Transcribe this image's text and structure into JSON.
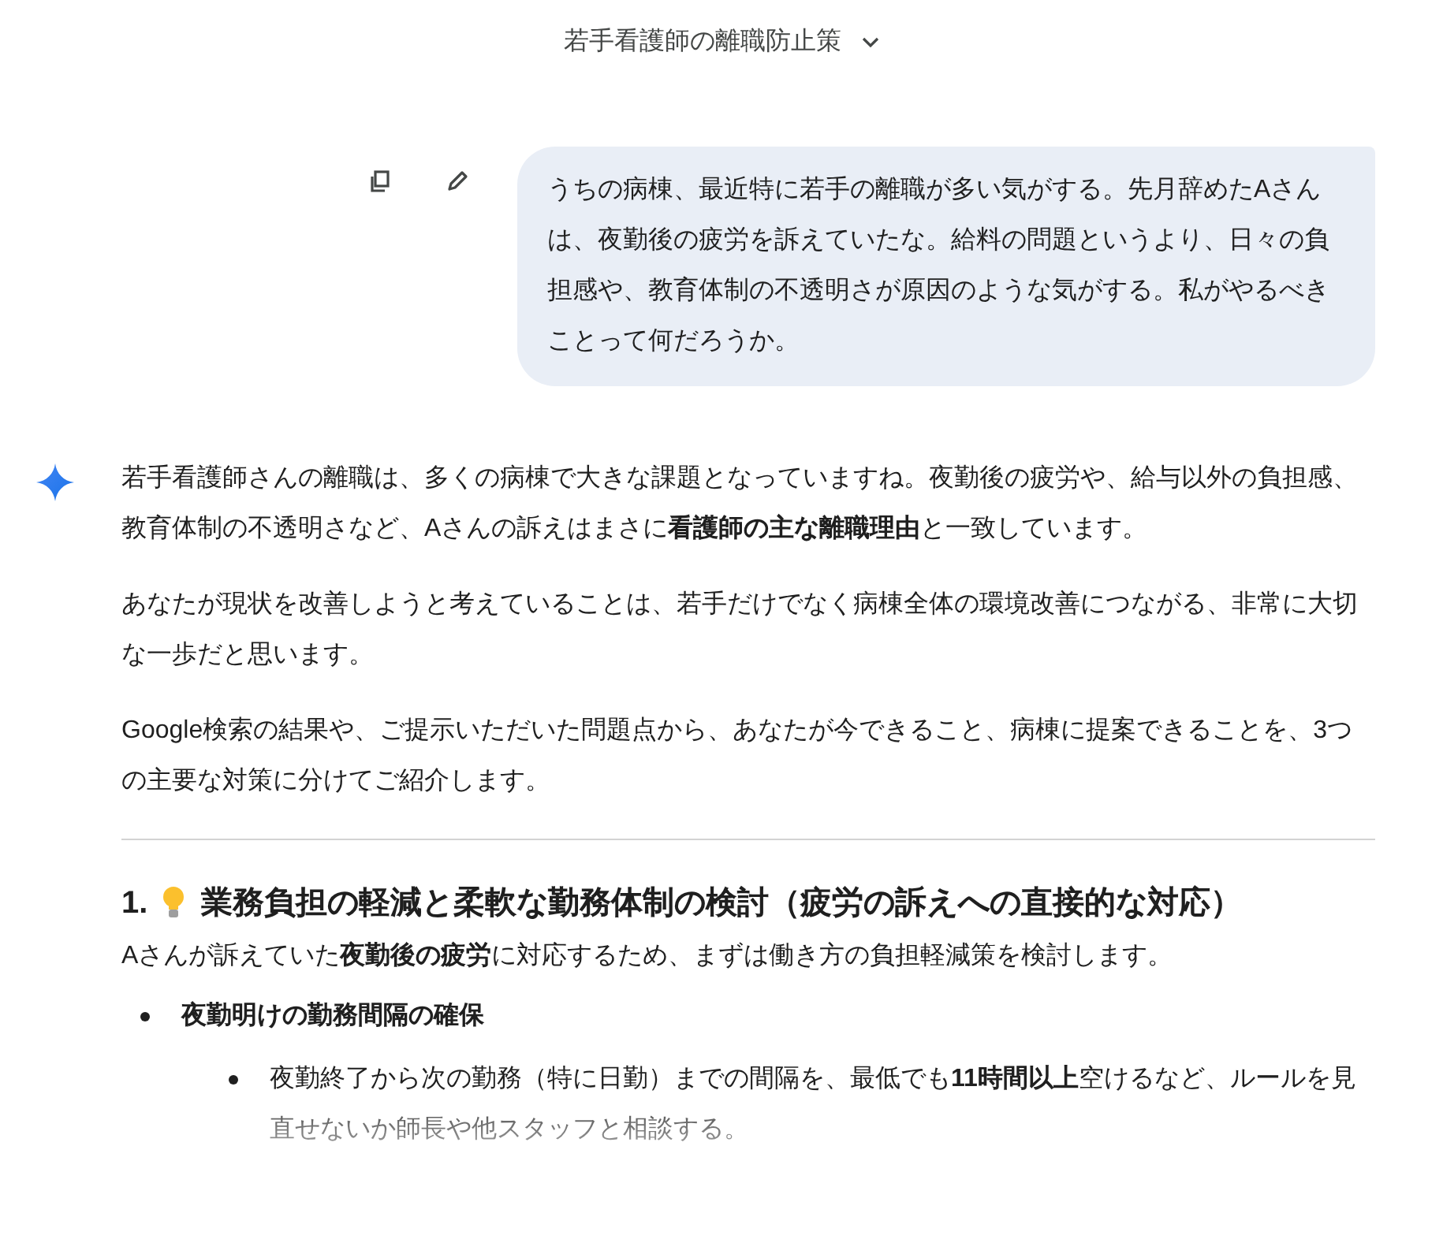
{
  "header": {
    "title": "若手看護師の離職防止策"
  },
  "user_message": {
    "text": "うちの病棟、最近特に若手の離職が多い気がする。先月辞めたAさんは、夜勤後の疲労を訴えていたな。給料の問題というより、日々の負担感や、教育体制の不透明さが原因のような気がする。私がやるべきことって何だろうか。"
  },
  "response": {
    "paragraphs": [
      "若手看護師さんの離職は、多くの病棟で大きな課題となっていますね。夜勤後の疲労や、給与以外の負担感、教育体制の不透明さなど、Aさんの訴えはまさに**看護師の主な離職理由**と一致しています。",
      "あなたが現状を改善しようと考えていることは、若手だけでなく病棟全体の環境改善につながる、非常に大切な一歩だと思います。",
      "Google検索の結果や、ご提示いただいた問題点から、あなたが今できること、病棟に提案できることを、3つの主要な対策に分けてご紹介します。"
    ],
    "sections": [
      {
        "number": "1.",
        "heading": "業務負担の軽減と柔軟な勤務体制の検討（疲労の訴えへの直接的な対応）",
        "intro": "Aさんが訴えていた**夜勤後の疲労**に対応するため、まずは働き方の負担軽減策を検討します。",
        "bullets": [
          {
            "text": "夜勤明けの勤務間隔の確保",
            "children": [
              {
                "text": "夜勤終了から次の勤務（特に日勤）までの間隔を、最低でも**11時間以上**空けるなど、ルールを見直せないか師長や他スタッフと相談する。"
              }
            ]
          }
        ]
      }
    ]
  }
}
